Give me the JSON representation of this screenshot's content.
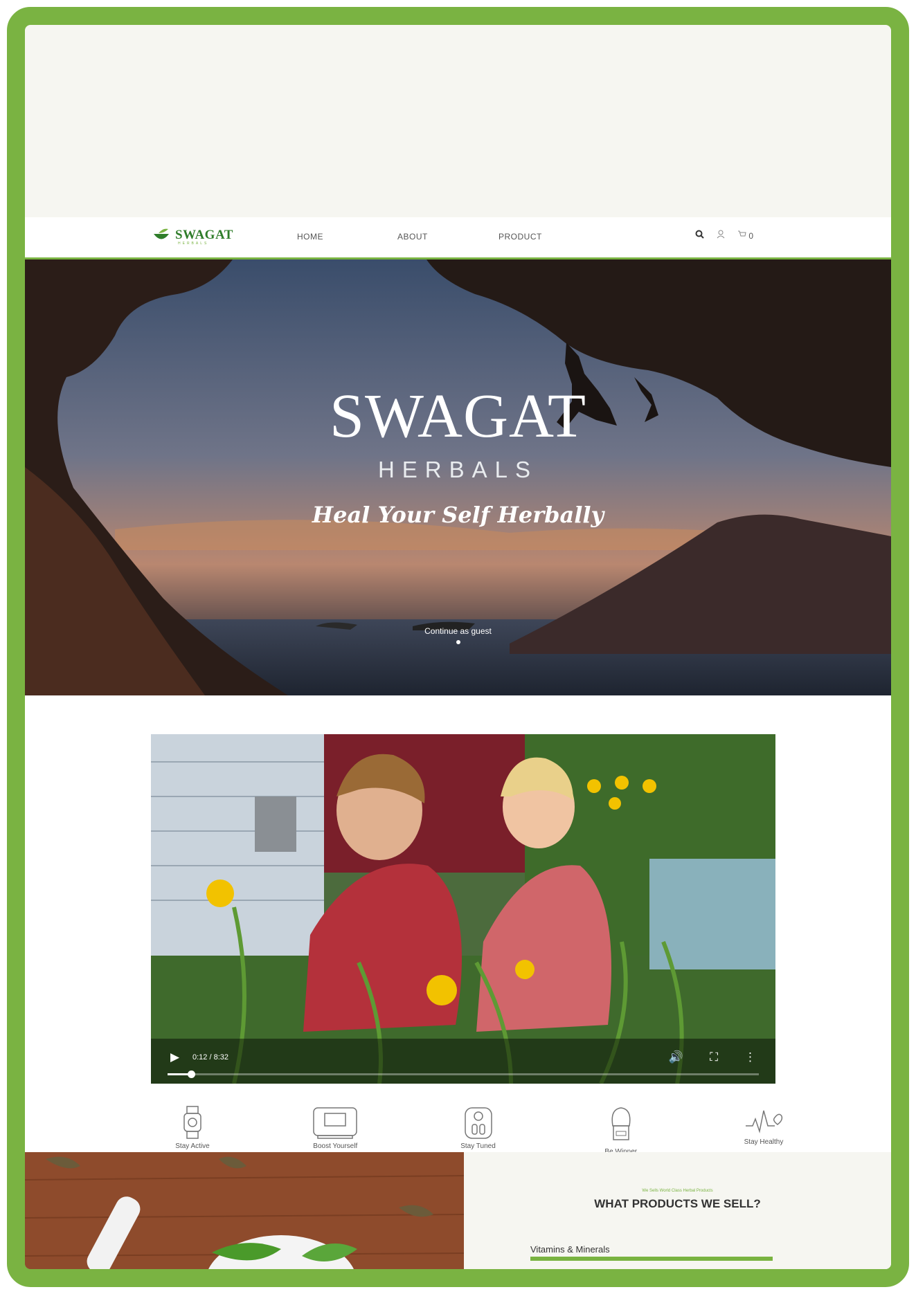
{
  "colors": {
    "brand_green": "#79b341",
    "frame_green": "#7ab342",
    "page_bg": "#f6f6f1"
  },
  "nav": {
    "logo_text": "SWAGAT",
    "logo_sub": "HERBALS",
    "links": [
      "HOME",
      "ABOUT",
      "PRODUCT"
    ],
    "icons": [
      "search-icon",
      "user-icon",
      "cart-icon"
    ],
    "cart_count": "0"
  },
  "hero": {
    "title": "SWAGAT",
    "subtitle": "HERBALS",
    "tagline": "Heal Your Self Herbally",
    "guest_link": "Continue as guest"
  },
  "video": {
    "time": "0:12 / 8:32",
    "progress": 0.04
  },
  "features": [
    {
      "label": "Stay Active",
      "icon": "smartwatch-icon"
    },
    {
      "label": "Boost Yourself",
      "icon": "scale-icon"
    },
    {
      "label": "Stay Tuned",
      "icon": "weight-scale-icon"
    },
    {
      "label": "Be Winner",
      "icon": "boxing-glove-icon"
    },
    {
      "label": "Stay Healthy",
      "icon": "heart-rate-icon"
    }
  ],
  "products_section": {
    "eyebrow": "We Sells World Class Herbal Products",
    "title": "WHAT PRODUCTS WE SELL?",
    "first_item": "Vitamins & Minerals"
  }
}
